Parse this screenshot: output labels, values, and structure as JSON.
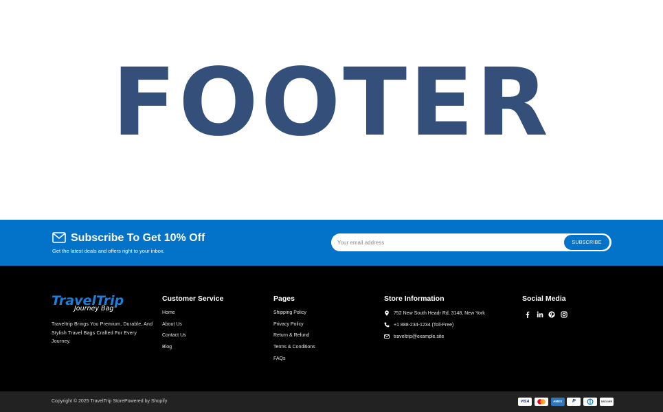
{
  "hero": {
    "title": "FOOTER"
  },
  "subscribe": {
    "icon": "mail-icon",
    "title": "Subscribe To Get 10% Off",
    "text": "Get the latest deals and offers right to your inbox.",
    "email_placeholder": "Your email address",
    "email_value": "",
    "button_label": "SUBSCRIBE"
  },
  "brand": {
    "logo_main": "TravelTrip",
    "logo_sub": "Journey Bag",
    "description": "Traveltrip Brings You Premium, Durable, And Stylish Travel Bags Crafted For Every Journey."
  },
  "customer_service": {
    "title": "Customer Service",
    "links": [
      "Home",
      "About Us",
      "Contact Us",
      "Blog"
    ]
  },
  "pages": {
    "title": "Pages",
    "links": [
      "Shipping Policy",
      "Privacy Policy",
      "Return & Refund",
      "Terms & Conditions",
      "FAQs"
    ]
  },
  "store_info": {
    "title": "Store Information",
    "address": "752 New South Headr Rd, 3148, New York",
    "phone": "+1 888-234-1234 (Toll-Free)",
    "email": "traveltrip@example.site"
  },
  "social": {
    "title": "Social Media",
    "icons": [
      "facebook-icon",
      "linkedin-icon",
      "pinterest-icon",
      "instagram-icon"
    ]
  },
  "bottom": {
    "copyright": "Copyright © 2025 TravelTrip StorePowered by Shopify",
    "payments": [
      {
        "name": "visa-icon",
        "label": "VISA"
      },
      {
        "name": "mastercard-icon",
        "label": ""
      },
      {
        "name": "amex-icon",
        "label": "AMEX"
      },
      {
        "name": "paypal-icon",
        "label": "P"
      },
      {
        "name": "diners-club-icon",
        "label": ""
      },
      {
        "name": "discover-icon",
        "label": "DISCOVER"
      }
    ]
  },
  "colors": {
    "hero_text": "#34507a",
    "subscribe_band": "#0273c9",
    "footer_background": "#000000",
    "bottom_bar": "#222222",
    "logo_blue": "#1f7ed8"
  }
}
